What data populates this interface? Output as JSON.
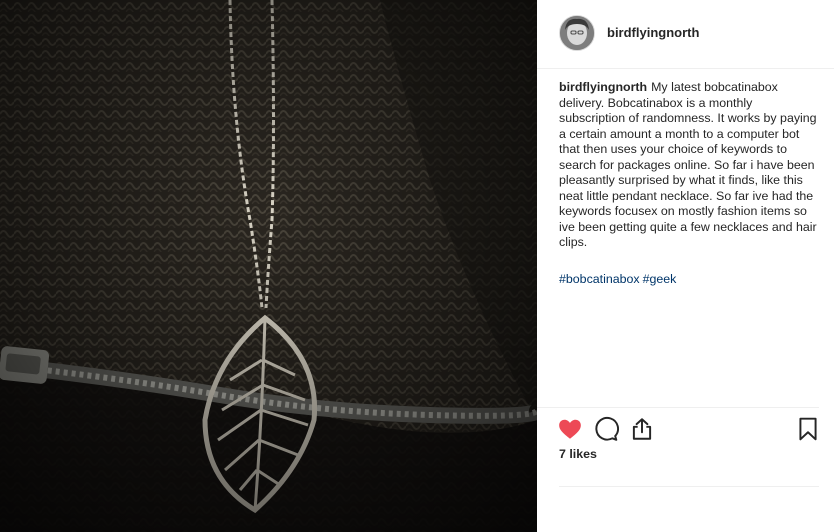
{
  "post": {
    "username": "birdflyingnorth",
    "caption_username": "birdflyingnorth",
    "caption_text": "My latest bobcatinabox delivery. Bobcatinabox is a monthly subscription of randomness. It works by paying a certain amount a month to a computer bot that then uses your choice of keywords to search for packages online. So far i have been pleasantly surprised by what it finds, like this neat little pendant necklace. So far ive had the keywords focusex on mostly fashion items so ive been getting quite a few necklaces and hair clips.",
    "hashtags": [
      "#bobcatinabox",
      "#geek"
    ],
    "likes": "7 likes",
    "liked": true
  },
  "icons": {
    "like": "heart-icon",
    "comment": "comment-bubble-icon",
    "share": "share-icon",
    "save": "bookmark-icon"
  },
  "colors": {
    "like_red": "#ed4956",
    "hashtag_blue": "#003569",
    "text": "#262626",
    "divider": "#efefef"
  }
}
